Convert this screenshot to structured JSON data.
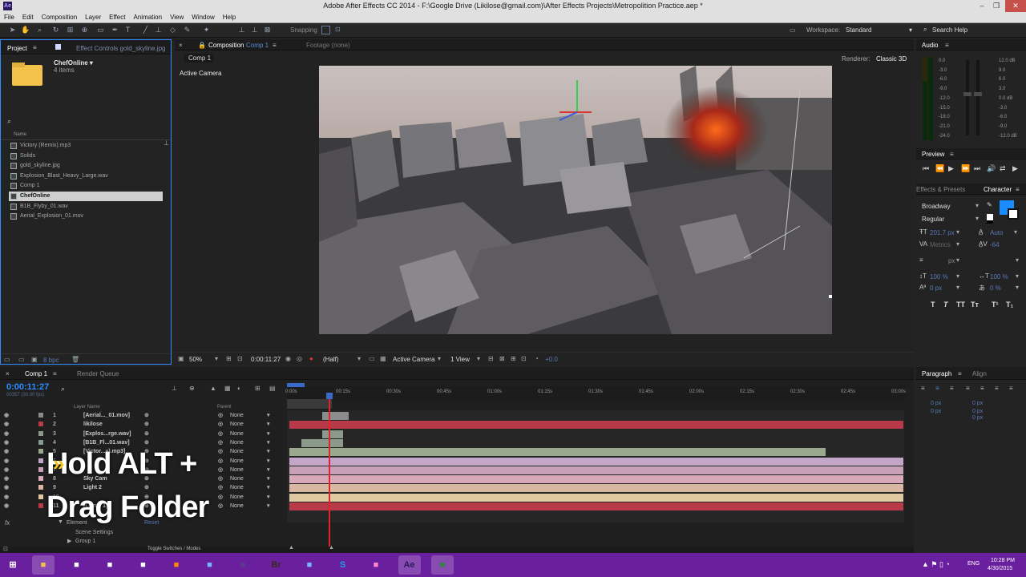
{
  "window": {
    "title": "Adobe After Effects CC 2014 - F:\\Google Drive (Likilose@gmail.com)\\After Effects Projects\\Metropolition Practice.aep *",
    "logo": "Ae"
  },
  "menu": [
    "File",
    "Edit",
    "Composition",
    "Layer",
    "Effect",
    "Animation",
    "View",
    "Window",
    "Help"
  ],
  "toolbar": {
    "snapping": "Snapping",
    "workspace_label": "Workspace:",
    "workspace_value": "Standard",
    "search_help": "Search Help"
  },
  "project": {
    "tab_label": "Project",
    "effect_controls": "Effect Controls gold_skyline.jpg",
    "folder_name": "ChefOnline ▾",
    "folder_items": "4 items",
    "col_name": "Name",
    "items": [
      {
        "label": "Victory (Remix).mp3",
        "selected": false
      },
      {
        "label": "Solids",
        "selected": false
      },
      {
        "label": "gold_skyline.jpg",
        "selected": false
      },
      {
        "label": "Explosion_Blast_Heavy_Large.wav",
        "selected": false
      },
      {
        "label": "Comp 1",
        "selected": false
      },
      {
        "label": "ChefOnline",
        "selected": true
      },
      {
        "label": "B1B_Flyby_01.wav",
        "selected": false
      },
      {
        "label": "Aerial_Explosion_01.mov",
        "selected": false
      }
    ],
    "bpc": "8 bpc"
  },
  "composition": {
    "tab_label": "Composition",
    "tab_comp": "Comp 1",
    "footage": "Footage (none)",
    "subtab": "Comp 1",
    "renderer_label": "Renderer:",
    "renderer_value": "Classic 3D",
    "active_camera": "Active Camera",
    "zoom": "50%",
    "timecode": "0:00:11:27",
    "resolution": "(Half)",
    "view_camera": "Active Camera",
    "views": "1 View",
    "exposure": "+0.0"
  },
  "audio": {
    "title": "Audio",
    "left_scale": [
      "0.0",
      "-3.0",
      "-6.0",
      "-9.0",
      "-12.0",
      "-15.0",
      "-18.0",
      "-21.0",
      "-24.0"
    ],
    "right_scale": [
      "12.0 dB",
      "9.0",
      "6.0",
      "3.0",
      "0.0 dB",
      "-3.0",
      "-6.0",
      "-9.0",
      "-12.0 dB"
    ]
  },
  "preview": {
    "title": "Preview"
  },
  "character": {
    "effects_tab": "Effects & Presets",
    "title": "Character",
    "font": "Broadway",
    "style": "Regular",
    "size": "201.7 px",
    "leading": "Auto",
    "kerning": "Metrics",
    "tracking": "-64",
    "stroke": "px",
    "vscale": "100 %",
    "hscale": "100 %",
    "baseline": "0 px",
    "tsume": "0 %"
  },
  "paragraph": {
    "title": "Paragraph",
    "align_tab": "Align",
    "values": [
      "0 px",
      "0 px",
      "0 px",
      "0 px",
      "0 px"
    ]
  },
  "timeline": {
    "tab": "Comp 1",
    "render_queue": "Render Queue",
    "timecode": "0:00:11:27",
    "frames": "00357 (30.00 fps)",
    "col_layer": "Layer Name",
    "col_parent": "Parent",
    "ruler": [
      "0:00s",
      "00:15s",
      "00:30s",
      "00:45s",
      "01:00s",
      "01:15s",
      "01:30s",
      "01:45s",
      "02:00s",
      "02:15s",
      "02:30s",
      "02:45s",
      "03:00s"
    ],
    "layers": [
      {
        "num": "1",
        "name": "[Aerial..._01.mov]",
        "parent": "None"
      },
      {
        "num": "2",
        "name": "likilose",
        "parent": "None"
      },
      {
        "num": "3",
        "name": "[Explos...rge.wav]",
        "parent": "None"
      },
      {
        "num": "4",
        "name": "[B1B_Fl...01.wav]",
        "parent": "None"
      },
      {
        "num": "5",
        "name": "[Victor...x).mp3]",
        "parent": "None"
      },
      {
        "num": "6",
        "name": "",
        "parent": "None"
      },
      {
        "num": "7",
        "name": "",
        "parent": "None"
      },
      {
        "num": "8",
        "name": "Sky Cam",
        "parent": "None"
      },
      {
        "num": "9",
        "name": "Light 2",
        "parent": "None"
      },
      {
        "num": "10",
        "name": "",
        "parent": "None"
      },
      {
        "num": "11",
        "name": "[Comp 1]",
        "parent": "None"
      }
    ],
    "element": "Element",
    "reset": "Reset",
    "scene_settings": "Scene Settings",
    "group": "Group 1",
    "toggle": "Toggle Switches / Modes",
    "colors": [
      "#8c8c8c",
      "#b83a48",
      "#8c9a8c",
      "#8c9a8c",
      "#9aa88c",
      "#c3a6c8",
      "#c8a0b8",
      "#d8a8b8",
      "#d8b8a0",
      "#e0c8a0",
      "#b83a48"
    ]
  },
  "overlay": {
    "line1": "Hold ALT +",
    "line2": "Drag Folder"
  },
  "taskbar": {
    "time": "10:28 PM",
    "date": "4/30/2015",
    "lang": "ENG",
    "apps": [
      "file-explorer-icon",
      "chrome-icon",
      "tool-icon",
      "app-icon",
      "vlc-icon",
      "network-icon",
      "vs-icon",
      "Br",
      "web-icon",
      "S",
      "paint-icon",
      "Ae",
      "app2-icon"
    ]
  }
}
